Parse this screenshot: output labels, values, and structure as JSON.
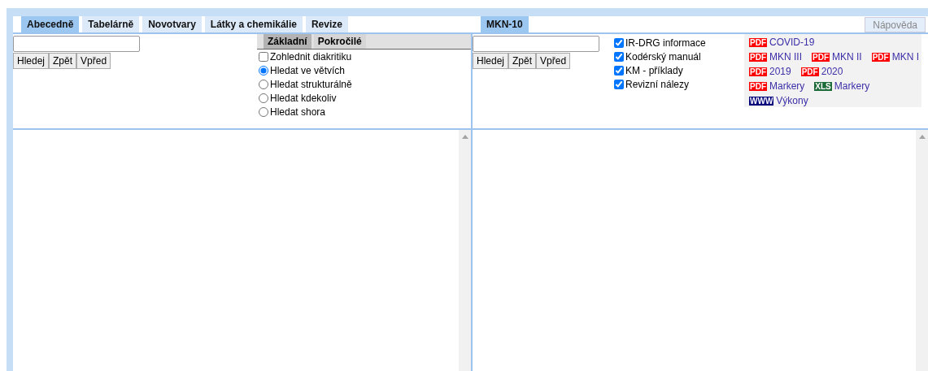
{
  "tabs": [
    {
      "label": "Abecedně",
      "selected": true
    },
    {
      "label": "Tabelárně",
      "selected": false
    },
    {
      "label": "Novotvary",
      "selected": false
    },
    {
      "label": "Látky a chemikálie",
      "selected": false
    },
    {
      "label": "Revize",
      "selected": false
    }
  ],
  "right_tabs": [
    {
      "label": "MKN-10",
      "selected": true
    }
  ],
  "help_button": "Nápověda",
  "left": {
    "buttons": [
      "Hledej",
      "Zpět",
      "Vpřed"
    ],
    "option_tabs": [
      {
        "label": "Základní",
        "selected": true
      },
      {
        "label": "Pokročilé",
        "selected": false
      }
    ],
    "options": [
      {
        "kind": "checkbox",
        "label": "Zohlednit diakritiku",
        "checked": false
      },
      {
        "kind": "radio",
        "label": "Hledat ve větvích",
        "selected": true
      },
      {
        "kind": "radio",
        "label": "Hledat strukturálně",
        "selected": false
      },
      {
        "kind": "radio",
        "label": "Hledat kdekoliv",
        "selected": false
      },
      {
        "kind": "radio",
        "label": "Hledat shora",
        "selected": false
      }
    ]
  },
  "right": {
    "buttons": [
      "Hledej",
      "Zpět",
      "Vpřed"
    ],
    "checkboxes": [
      {
        "label": "IR-DRG informace",
        "checked": true
      },
      {
        "label": "Kodérský manuál",
        "checked": true
      },
      {
        "label": "KM - příklady",
        "checked": true
      },
      {
        "label": "Revizní nálezy",
        "checked": true
      }
    ],
    "link_rows": [
      [
        {
          "kind": "pdf",
          "badge": "PDF",
          "label": "COVID-19"
        }
      ],
      [
        {
          "kind": "pdf",
          "badge": "PDF",
          "label": "MKN III"
        },
        {
          "kind": "pdf",
          "badge": "PDF",
          "label": "MKN II"
        },
        {
          "kind": "pdf",
          "badge": "PDF",
          "label": "MKN I"
        }
      ],
      [
        {
          "kind": "pdf",
          "badge": "PDF",
          "label": "2019"
        },
        {
          "kind": "pdf",
          "badge": "PDF",
          "label": "2020"
        }
      ],
      [
        {
          "kind": "pdf",
          "badge": "PDF",
          "label": "Markery"
        },
        {
          "kind": "xls",
          "badge": "XLS",
          "label": "Markery"
        }
      ],
      [
        {
          "kind": "www",
          "badge": "WWW",
          "label": "Výkony"
        }
      ]
    ]
  }
}
